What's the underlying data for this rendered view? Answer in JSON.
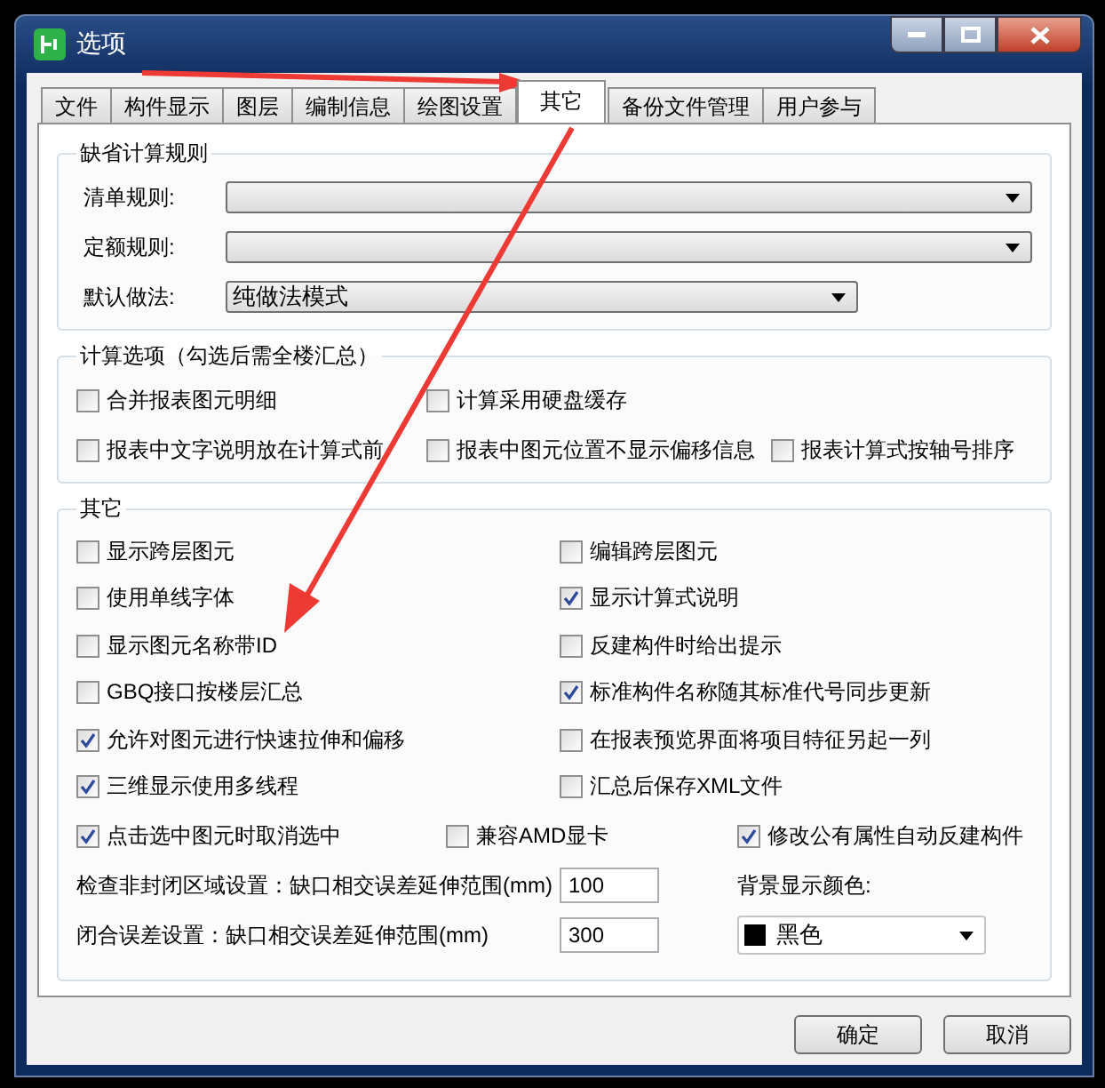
{
  "window": {
    "title": "选项"
  },
  "tabs": [
    {
      "label": "文件",
      "selected": false
    },
    {
      "label": "构件显示",
      "selected": false
    },
    {
      "label": "图层",
      "selected": false
    },
    {
      "label": "编制信息",
      "selected": false
    },
    {
      "label": "绘图设置",
      "selected": false
    },
    {
      "label": "其它",
      "selected": true
    },
    {
      "label": "备份文件管理",
      "selected": false
    },
    {
      "label": "用户参与",
      "selected": false
    }
  ],
  "default_rules": {
    "title": "缺省计算规则",
    "fields": [
      {
        "label": "清单规则:"
      },
      {
        "label": "定额规则:"
      },
      {
        "label": "默认做法:",
        "value": "纯做法模式"
      }
    ]
  },
  "calc_options": {
    "title": "计算选项（勾选后需全楼汇总）",
    "rows": [
      [
        {
          "label": "合并报表图元明细",
          "checked": false
        },
        {
          "label": "计算采用硬盘缓存",
          "checked": false
        }
      ],
      [
        {
          "label": "报表中文字说明放在计算式前",
          "checked": false
        },
        {
          "label": "报表中图元位置不显示偏移信息",
          "checked": false
        },
        {
          "label": "报表计算式按轴号排序",
          "checked": false
        }
      ]
    ]
  },
  "other": {
    "title": "其它",
    "rows": [
      [
        {
          "label": "显示跨层图元",
          "checked": false
        },
        {
          "label": "编辑跨层图元",
          "checked": false
        }
      ],
      [
        {
          "label": "使用单线字体",
          "checked": false
        },
        {
          "label": "显示计算式说明",
          "checked": true
        }
      ],
      [
        {
          "label": "显示图元名称带ID",
          "checked": false
        },
        {
          "label": "反建构件时给出提示",
          "checked": false
        }
      ],
      [
        {
          "label": "GBQ接口按楼层汇总",
          "checked": false
        },
        {
          "label": "标准构件名称随其标准代号同步更新",
          "checked": true
        }
      ],
      [
        {
          "label": "允许对图元进行快速拉伸和偏移",
          "checked": true
        },
        {
          "label": "在报表预览界面将项目特征另起一列",
          "checked": false
        }
      ],
      [
        {
          "label": "三维显示使用多线程",
          "checked": true
        },
        {
          "label": "汇总后保存XML文件",
          "checked": false
        }
      ],
      [
        {
          "label": "点击选中图元时取消选中",
          "checked": true
        },
        {
          "label": "兼容AMD显卡",
          "checked": false
        },
        {
          "label": "修改公有属性自动反建构件",
          "checked": true
        }
      ]
    ],
    "settings": [
      {
        "label": "检查非封闭区域设置：缺口相交误差延伸范围(mm)",
        "value": "100"
      },
      {
        "label": "闭合误差设置：缺口相交误差延伸范围(mm)",
        "value": "300"
      }
    ],
    "background": {
      "label": "背景显示颜色:",
      "value": "黑色",
      "color": "#000000"
    }
  },
  "buttons": [
    "确定",
    "取消"
  ]
}
